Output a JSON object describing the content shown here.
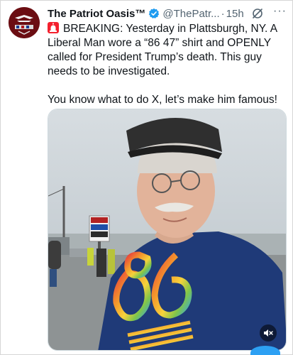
{
  "post": {
    "display_name": "The Patriot Oasis™",
    "handle": "@ThePatr...",
    "separator": "·",
    "timestamp": "15h",
    "text_line": "BREAKING: Yesterday in Plattsburgh, NY. A Liberal Man wore a “86 47” shirt and OPENLY called for President Trump’s death. This guy needs to be investigated.",
    "text_line_2": "You know what to do X, let’s make him famous!",
    "more_glyph": "···",
    "icons": {
      "avatar": "patriot-oasis-logo",
      "verified": "verified-badge-icon",
      "grok": "grok-icon",
      "siren": "siren-emoji",
      "mute": "speaker-muted-icon"
    }
  },
  "media": {
    "type": "video",
    "sign_brand": "LOWE'S",
    "muted": true
  },
  "colors": {
    "accent": "#1d9bf0",
    "text": "#0f1419",
    "secondary_text": "#536471",
    "shirt": "#1f3a78"
  }
}
